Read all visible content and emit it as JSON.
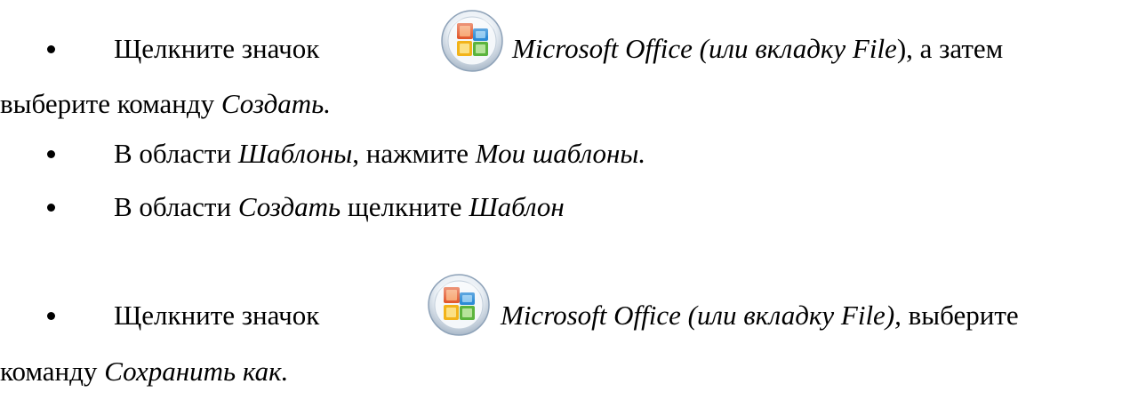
{
  "items": [
    {
      "line1": {
        "a": "Щелкните значок ",
        "b": "Microsoft Office (или вкладку File",
        "c": "), а затем"
      },
      "line2": {
        "a": "выберите команду ",
        "b": "Создать."
      }
    },
    {
      "a": "В области ",
      "b": "Шаблоны",
      "c": ", нажмите ",
      "d": "Мои шаблоны."
    },
    {
      "a": "В области ",
      "b": "Создать",
      "c": " щелкните ",
      "d": "Шаблон"
    },
    {
      "line1": {
        "a": "Щелкните значок ",
        "b": "Microsoft Office (или вкладку File),",
        "c": " выберите"
      },
      "line2": {
        "a": "команду ",
        "b": "Сохранить как."
      }
    }
  ],
  "icons": {
    "office_button": "microsoft-office-button-icon"
  }
}
